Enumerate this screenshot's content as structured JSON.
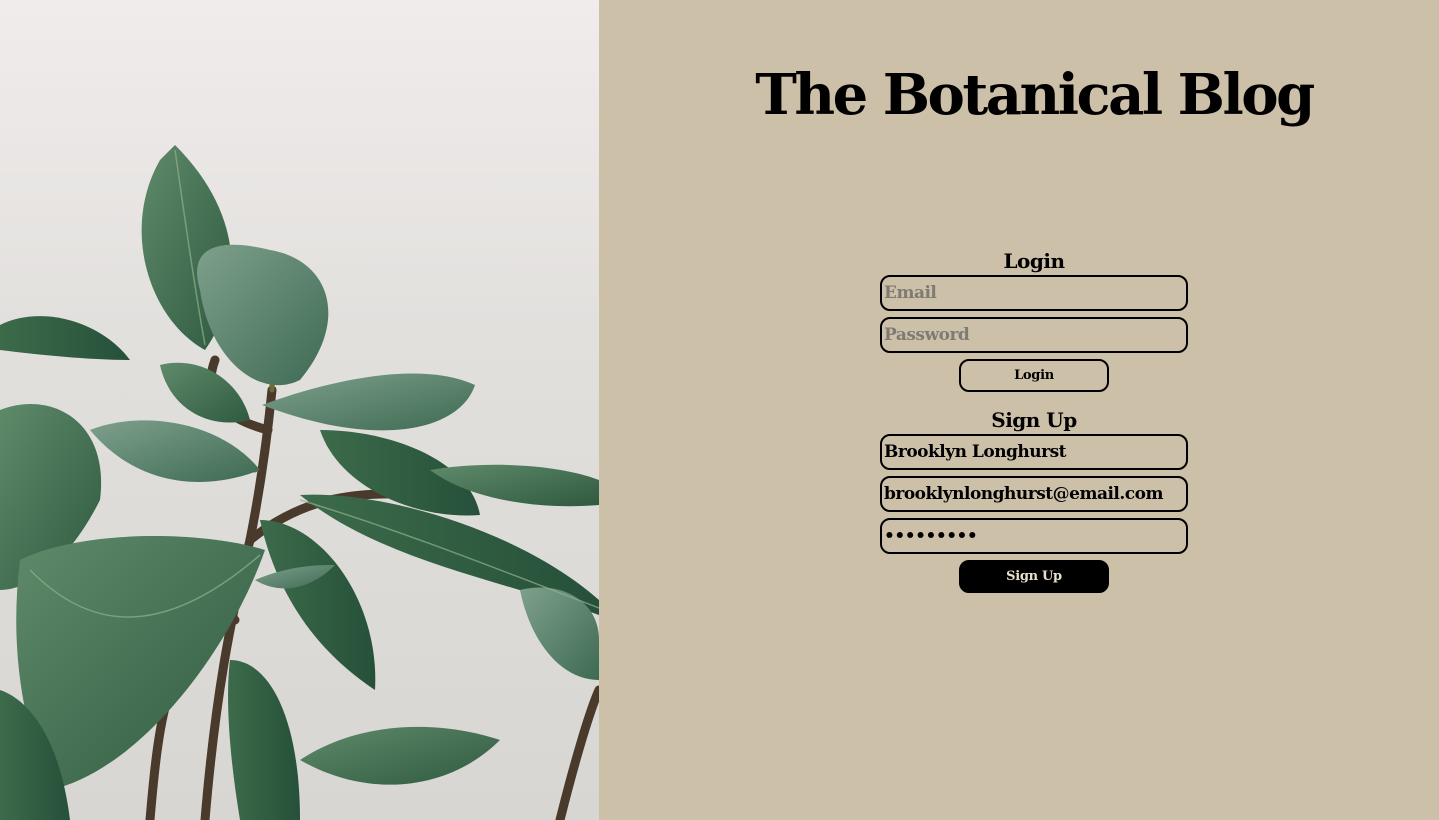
{
  "site": {
    "title": "The Botanical Blog"
  },
  "login": {
    "heading": "Login",
    "email_placeholder": "Email",
    "email_value": "",
    "password_placeholder": "Password",
    "password_value": "",
    "button_label": "Login"
  },
  "signup": {
    "heading": "Sign Up",
    "name_value": "Brooklyn Longhurst",
    "email_value": "brooklynlonghurst@email.com",
    "password_value": "•••••••••",
    "button_label": "Sign Up"
  },
  "colors": {
    "page_background": "#cdc0a8",
    "text": "#000000",
    "placeholder": "#7f7a72",
    "signup_button_bg": "#000000",
    "signup_button_text": "#e8dfcc"
  }
}
